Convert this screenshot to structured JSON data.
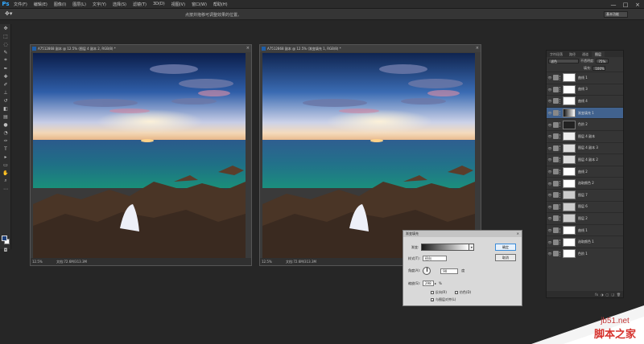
{
  "app": {
    "logo": "Ps"
  },
  "menu": [
    "文件(F)",
    "编辑(E)",
    "图像(I)",
    "图层(L)",
    "文字(Y)",
    "选择(S)",
    "滤镜(T)",
    "3D(D)",
    "视图(V)",
    "窗口(W)",
    "帮助(H)"
  ],
  "window_controls": [
    "—",
    "□",
    "×"
  ],
  "options": {
    "hint": "点按并拖移可调整效果的位置。",
    "workspace": "基本功能"
  },
  "docs": [
    {
      "title": "A7512868 副本 @ 12.5% (图层 4 副本 2, RGB/8) *",
      "zoom": "12.5%",
      "doc": "文档:72.6M/313.3M",
      "close": "×"
    },
    {
      "title": "A7512868 副本 @ 12.5% (渐变填充 1, RGB/8) *",
      "zoom": "12.5%",
      "doc": "文档:72.6M/313.3M",
      "close": "×"
    }
  ],
  "layers_panel": {
    "tabs": [
      "字符段落",
      "路径",
      "通道",
      "图层"
    ],
    "mode": "滤色",
    "opacity_label": "不透明度:",
    "opacity": "75%",
    "fill_label": "填充:",
    "fill": "100%",
    "layers": [
      {
        "name": "曲线 1",
        "selected": false
      },
      {
        "name": "曲线 3",
        "selected": false
      },
      {
        "name": "曲线 4",
        "selected": false
      },
      {
        "name": "渐变填充 1",
        "selected": true
      },
      {
        "name": "色阶 2",
        "selected": false
      },
      {
        "name": "图层 4 副本",
        "selected": false
      },
      {
        "name": "图层 4 副本 3",
        "selected": false
      },
      {
        "name": "图层 4 副本 2",
        "selected": false
      },
      {
        "name": "曲线 2",
        "selected": false
      },
      {
        "name": "选取颜色 2",
        "selected": false
      },
      {
        "name": "图层 7",
        "selected": false
      },
      {
        "name": "图层 6",
        "selected": false
      },
      {
        "name": "图层 2",
        "selected": false
      },
      {
        "name": "曲线 1",
        "selected": false
      },
      {
        "name": "选取颜色 1",
        "selected": false
      },
      {
        "name": "色阶 1",
        "selected": false
      }
    ],
    "footer_icons": [
      "fx",
      "◑",
      "▢",
      "❏",
      "🗑"
    ]
  },
  "dialog": {
    "title": "渐变填充",
    "close": "×",
    "gradient_label": "渐变:",
    "style_label": "样式(T):",
    "style_value": "径向",
    "angle_label": "角度(A):",
    "angle_value": "90",
    "angle_unit": "度",
    "scale_label": "缩放(S):",
    "scale_value": "298",
    "scale_unit": "%",
    "reverse_label": "反向(R)",
    "dither_label": "仿色(D)",
    "align_label": "与图层对齐(L)",
    "ok": "确定",
    "cancel": "取消"
  },
  "watermark": {
    "line1": "jb51.net",
    "line2": "脚本之家"
  }
}
